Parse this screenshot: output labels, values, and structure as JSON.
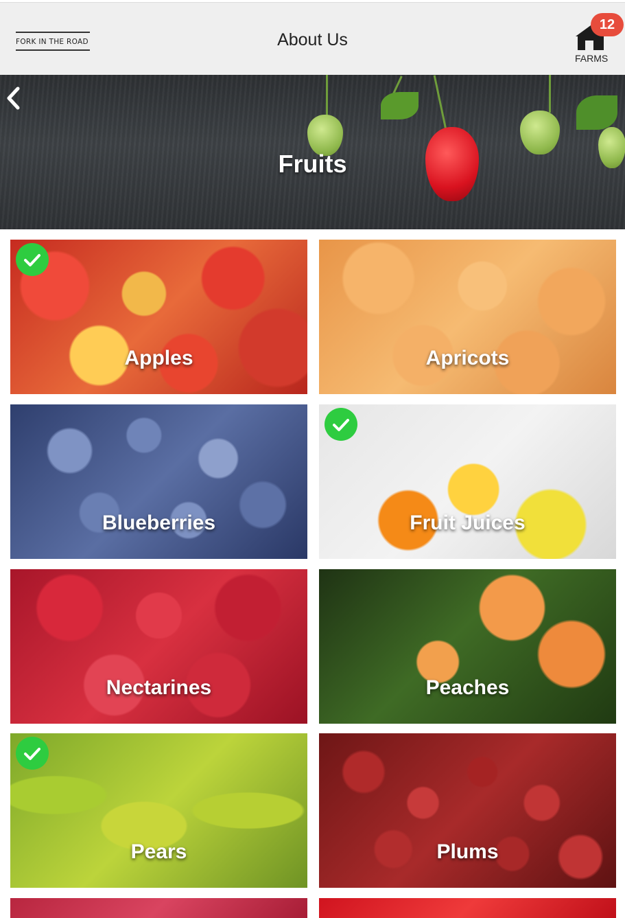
{
  "header": {
    "logo_text": "FORK IN THE ROAD",
    "title": "About Us",
    "farms_label": "FARMS",
    "farms_badge": "12"
  },
  "hero": {
    "title": "Fruits"
  },
  "categories": [
    {
      "label": "Apples",
      "checked": true
    },
    {
      "label": "Apricots",
      "checked": false
    },
    {
      "label": "Blueberries",
      "checked": false
    },
    {
      "label": "Fruit Juices",
      "checked": true
    },
    {
      "label": "Nectarines",
      "checked": false
    },
    {
      "label": "Peaches",
      "checked": false
    },
    {
      "label": "Pears",
      "checked": true
    },
    {
      "label": "Plums",
      "checked": false
    },
    {
      "label": "",
      "checked": false
    },
    {
      "label": "",
      "checked": false
    }
  ],
  "icons": {
    "back": "chevron-left-icon",
    "farms": "barn-icon",
    "check": "checkmark-icon"
  },
  "colors": {
    "badge": "#e74c3c",
    "check": "#2ecc40",
    "topbar": "#efefef"
  }
}
